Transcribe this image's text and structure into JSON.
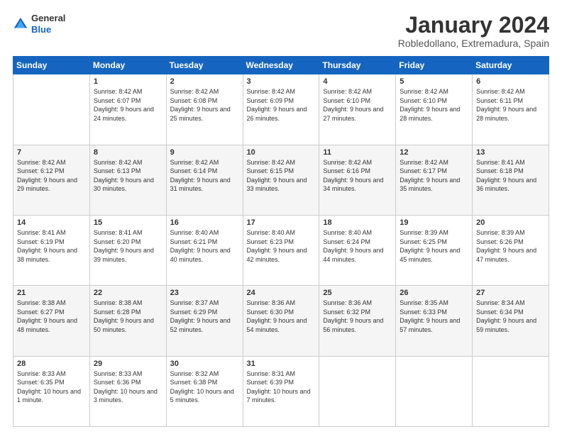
{
  "logo": {
    "general": "General",
    "blue": "Blue"
  },
  "header": {
    "title": "January 2024",
    "subtitle": "Robledollano, Extremadura, Spain"
  },
  "weekdays": [
    "Sunday",
    "Monday",
    "Tuesday",
    "Wednesday",
    "Thursday",
    "Friday",
    "Saturday"
  ],
  "weeks": [
    [
      {
        "day": "",
        "sunrise": "",
        "sunset": "",
        "daylight": ""
      },
      {
        "day": "1",
        "sunrise": "Sunrise: 8:42 AM",
        "sunset": "Sunset: 6:07 PM",
        "daylight": "Daylight: 9 hours and 24 minutes."
      },
      {
        "day": "2",
        "sunrise": "Sunrise: 8:42 AM",
        "sunset": "Sunset: 6:08 PM",
        "daylight": "Daylight: 9 hours and 25 minutes."
      },
      {
        "day": "3",
        "sunrise": "Sunrise: 8:42 AM",
        "sunset": "Sunset: 6:09 PM",
        "daylight": "Daylight: 9 hours and 26 minutes."
      },
      {
        "day": "4",
        "sunrise": "Sunrise: 8:42 AM",
        "sunset": "Sunset: 6:10 PM",
        "daylight": "Daylight: 9 hours and 27 minutes."
      },
      {
        "day": "5",
        "sunrise": "Sunrise: 8:42 AM",
        "sunset": "Sunset: 6:10 PM",
        "daylight": "Daylight: 9 hours and 28 minutes."
      },
      {
        "day": "6",
        "sunrise": "Sunrise: 8:42 AM",
        "sunset": "Sunset: 6:11 PM",
        "daylight": "Daylight: 9 hours and 28 minutes."
      }
    ],
    [
      {
        "day": "7",
        "sunrise": "Sunrise: 8:42 AM",
        "sunset": "Sunset: 6:12 PM",
        "daylight": "Daylight: 9 hours and 29 minutes."
      },
      {
        "day": "8",
        "sunrise": "Sunrise: 8:42 AM",
        "sunset": "Sunset: 6:13 PM",
        "daylight": "Daylight: 9 hours and 30 minutes."
      },
      {
        "day": "9",
        "sunrise": "Sunrise: 8:42 AM",
        "sunset": "Sunset: 6:14 PM",
        "daylight": "Daylight: 9 hours and 31 minutes."
      },
      {
        "day": "10",
        "sunrise": "Sunrise: 8:42 AM",
        "sunset": "Sunset: 6:15 PM",
        "daylight": "Daylight: 9 hours and 33 minutes."
      },
      {
        "day": "11",
        "sunrise": "Sunrise: 8:42 AM",
        "sunset": "Sunset: 6:16 PM",
        "daylight": "Daylight: 9 hours and 34 minutes."
      },
      {
        "day": "12",
        "sunrise": "Sunrise: 8:42 AM",
        "sunset": "Sunset: 6:17 PM",
        "daylight": "Daylight: 9 hours and 35 minutes."
      },
      {
        "day": "13",
        "sunrise": "Sunrise: 8:41 AM",
        "sunset": "Sunset: 6:18 PM",
        "daylight": "Daylight: 9 hours and 36 minutes."
      }
    ],
    [
      {
        "day": "14",
        "sunrise": "Sunrise: 8:41 AM",
        "sunset": "Sunset: 6:19 PM",
        "daylight": "Daylight: 9 hours and 38 minutes."
      },
      {
        "day": "15",
        "sunrise": "Sunrise: 8:41 AM",
        "sunset": "Sunset: 6:20 PM",
        "daylight": "Daylight: 9 hours and 39 minutes."
      },
      {
        "day": "16",
        "sunrise": "Sunrise: 8:40 AM",
        "sunset": "Sunset: 6:21 PM",
        "daylight": "Daylight: 9 hours and 40 minutes."
      },
      {
        "day": "17",
        "sunrise": "Sunrise: 8:40 AM",
        "sunset": "Sunset: 6:23 PM",
        "daylight": "Daylight: 9 hours and 42 minutes."
      },
      {
        "day": "18",
        "sunrise": "Sunrise: 8:40 AM",
        "sunset": "Sunset: 6:24 PM",
        "daylight": "Daylight: 9 hours and 44 minutes."
      },
      {
        "day": "19",
        "sunrise": "Sunrise: 8:39 AM",
        "sunset": "Sunset: 6:25 PM",
        "daylight": "Daylight: 9 hours and 45 minutes."
      },
      {
        "day": "20",
        "sunrise": "Sunrise: 8:39 AM",
        "sunset": "Sunset: 6:26 PM",
        "daylight": "Daylight: 9 hours and 47 minutes."
      }
    ],
    [
      {
        "day": "21",
        "sunrise": "Sunrise: 8:38 AM",
        "sunset": "Sunset: 6:27 PM",
        "daylight": "Daylight: 9 hours and 48 minutes."
      },
      {
        "day": "22",
        "sunrise": "Sunrise: 8:38 AM",
        "sunset": "Sunset: 6:28 PM",
        "daylight": "Daylight: 9 hours and 50 minutes."
      },
      {
        "day": "23",
        "sunrise": "Sunrise: 8:37 AM",
        "sunset": "Sunset: 6:29 PM",
        "daylight": "Daylight: 9 hours and 52 minutes."
      },
      {
        "day": "24",
        "sunrise": "Sunrise: 8:36 AM",
        "sunset": "Sunset: 6:30 PM",
        "daylight": "Daylight: 9 hours and 54 minutes."
      },
      {
        "day": "25",
        "sunrise": "Sunrise: 8:36 AM",
        "sunset": "Sunset: 6:32 PM",
        "daylight": "Daylight: 9 hours and 56 minutes."
      },
      {
        "day": "26",
        "sunrise": "Sunrise: 8:35 AM",
        "sunset": "Sunset: 6:33 PM",
        "daylight": "Daylight: 9 hours and 57 minutes."
      },
      {
        "day": "27",
        "sunrise": "Sunrise: 8:34 AM",
        "sunset": "Sunset: 6:34 PM",
        "daylight": "Daylight: 9 hours and 59 minutes."
      }
    ],
    [
      {
        "day": "28",
        "sunrise": "Sunrise: 8:33 AM",
        "sunset": "Sunset: 6:35 PM",
        "daylight": "Daylight: 10 hours and 1 minute."
      },
      {
        "day": "29",
        "sunrise": "Sunrise: 8:33 AM",
        "sunset": "Sunset: 6:36 PM",
        "daylight": "Daylight: 10 hours and 3 minutes."
      },
      {
        "day": "30",
        "sunrise": "Sunrise: 8:32 AM",
        "sunset": "Sunset: 6:38 PM",
        "daylight": "Daylight: 10 hours and 5 minutes."
      },
      {
        "day": "31",
        "sunrise": "Sunrise: 8:31 AM",
        "sunset": "Sunset: 6:39 PM",
        "daylight": "Daylight: 10 hours and 7 minutes."
      },
      {
        "day": "",
        "sunrise": "",
        "sunset": "",
        "daylight": ""
      },
      {
        "day": "",
        "sunrise": "",
        "sunset": "",
        "daylight": ""
      },
      {
        "day": "",
        "sunrise": "",
        "sunset": "",
        "daylight": ""
      }
    ]
  ]
}
